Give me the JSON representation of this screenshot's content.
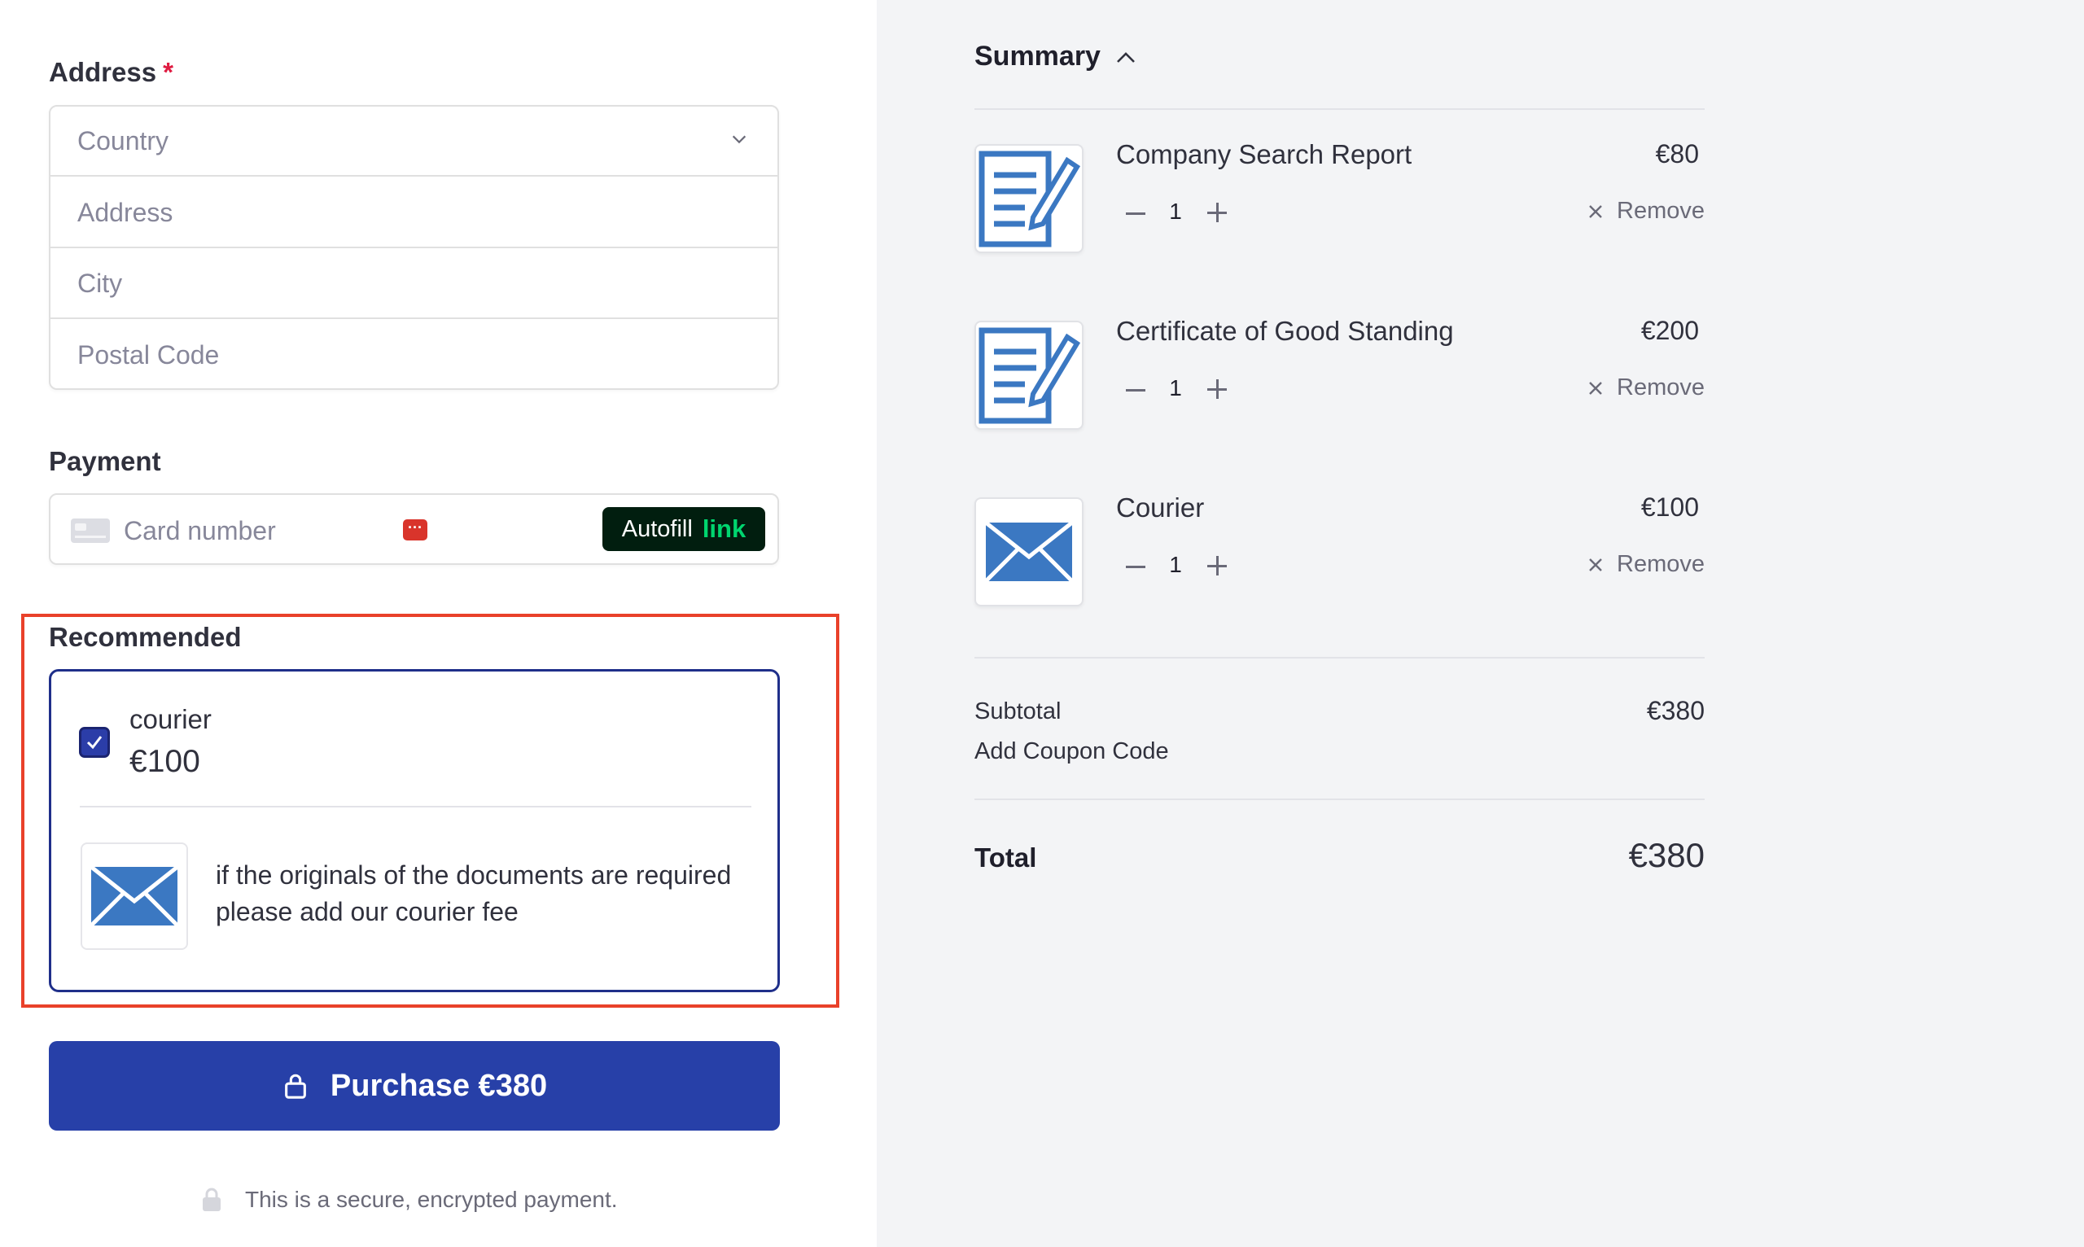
{
  "address": {
    "label": "Address",
    "required_mark": "*",
    "country_placeholder": "Country",
    "address_placeholder": "Address",
    "city_placeholder": "City",
    "postal_placeholder": "Postal Code"
  },
  "payment": {
    "label": "Payment",
    "card_placeholder": "Card number",
    "autofill_label": "Autofill",
    "link_label": "link"
  },
  "recommended": {
    "label": "Recommended",
    "checked": true,
    "item_name": "courier",
    "item_price": "€100",
    "description": "if the originals of the documents are required please add our courier fee"
  },
  "purchase_button": "Purchase €380",
  "secure_note": "This is a secure, encrypted payment.",
  "summary": {
    "title": "Summary",
    "items": [
      {
        "name": "Company Search Report",
        "price": "€80",
        "qty": "1",
        "remove": "Remove",
        "icon": "document-edit-icon"
      },
      {
        "name": "Certificate of Good Standing",
        "price": "€200",
        "qty": "1",
        "remove": "Remove",
        "icon": "document-edit-icon"
      },
      {
        "name": "Courier",
        "price": "€100",
        "qty": "1",
        "remove": "Remove",
        "icon": "envelope-icon"
      }
    ],
    "subtotal_label": "Subtotal",
    "subtotal_value": "€380",
    "coupon_label": "Add Coupon Code",
    "total_label": "Total",
    "total_value": "€380"
  },
  "colors": {
    "accent": "#2740a8",
    "highlight_frame": "#e9412a",
    "panel_bg": "#f3f4f6"
  }
}
